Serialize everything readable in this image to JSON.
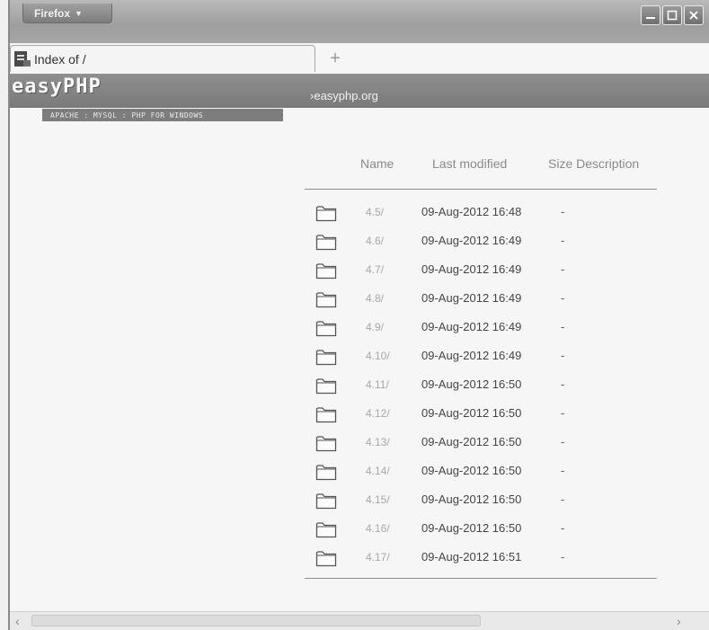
{
  "browser": {
    "menu_label": "Firefox",
    "tab_title": "Index of /",
    "new_tab": "+"
  },
  "header": {
    "logo": "easyPHP",
    "tagline": "APACHE : MYSQL : PHP FOR WINDOWS",
    "link": "easyphp.org"
  },
  "listing": {
    "columns": {
      "name": "Name",
      "modified": "Last modified",
      "size_desc": "Size Description"
    },
    "rows": [
      {
        "name": "4.5/",
        "modified": "09-Aug-2012 16:48",
        "size": "-"
      },
      {
        "name": "4.6/",
        "modified": "09-Aug-2012 16:49",
        "size": "-"
      },
      {
        "name": "4.7/",
        "modified": "09-Aug-2012 16:49",
        "size": "-"
      },
      {
        "name": "4.8/",
        "modified": "09-Aug-2012 16:49",
        "size": "-"
      },
      {
        "name": "4.9/",
        "modified": "09-Aug-2012 16:49",
        "size": "-"
      },
      {
        "name": "4.10/",
        "modified": "09-Aug-2012 16:49",
        "size": "-"
      },
      {
        "name": "4.11/",
        "modified": "09-Aug-2012 16:50",
        "size": "-"
      },
      {
        "name": "4.12/",
        "modified": "09-Aug-2012 16:50",
        "size": "-"
      },
      {
        "name": "4.13/",
        "modified": "09-Aug-2012 16:50",
        "size": "-"
      },
      {
        "name": "4.14/",
        "modified": "09-Aug-2012 16:50",
        "size": "-"
      },
      {
        "name": "4.15/",
        "modified": "09-Aug-2012 16:50",
        "size": "-"
      },
      {
        "name": "4.16/",
        "modified": "09-Aug-2012 16:50",
        "size": "-"
      },
      {
        "name": "4.17/",
        "modified": "09-Aug-2012 16:51",
        "size": "-"
      }
    ]
  },
  "icons": {
    "folder": "folder-icon",
    "minimize": "minimize-icon",
    "maximize": "maximize-icon",
    "close": "close-icon"
  },
  "colors": {
    "chrome": "#9e9e9e",
    "header_band": "#808080",
    "page_bg": "#f6f6f6"
  }
}
